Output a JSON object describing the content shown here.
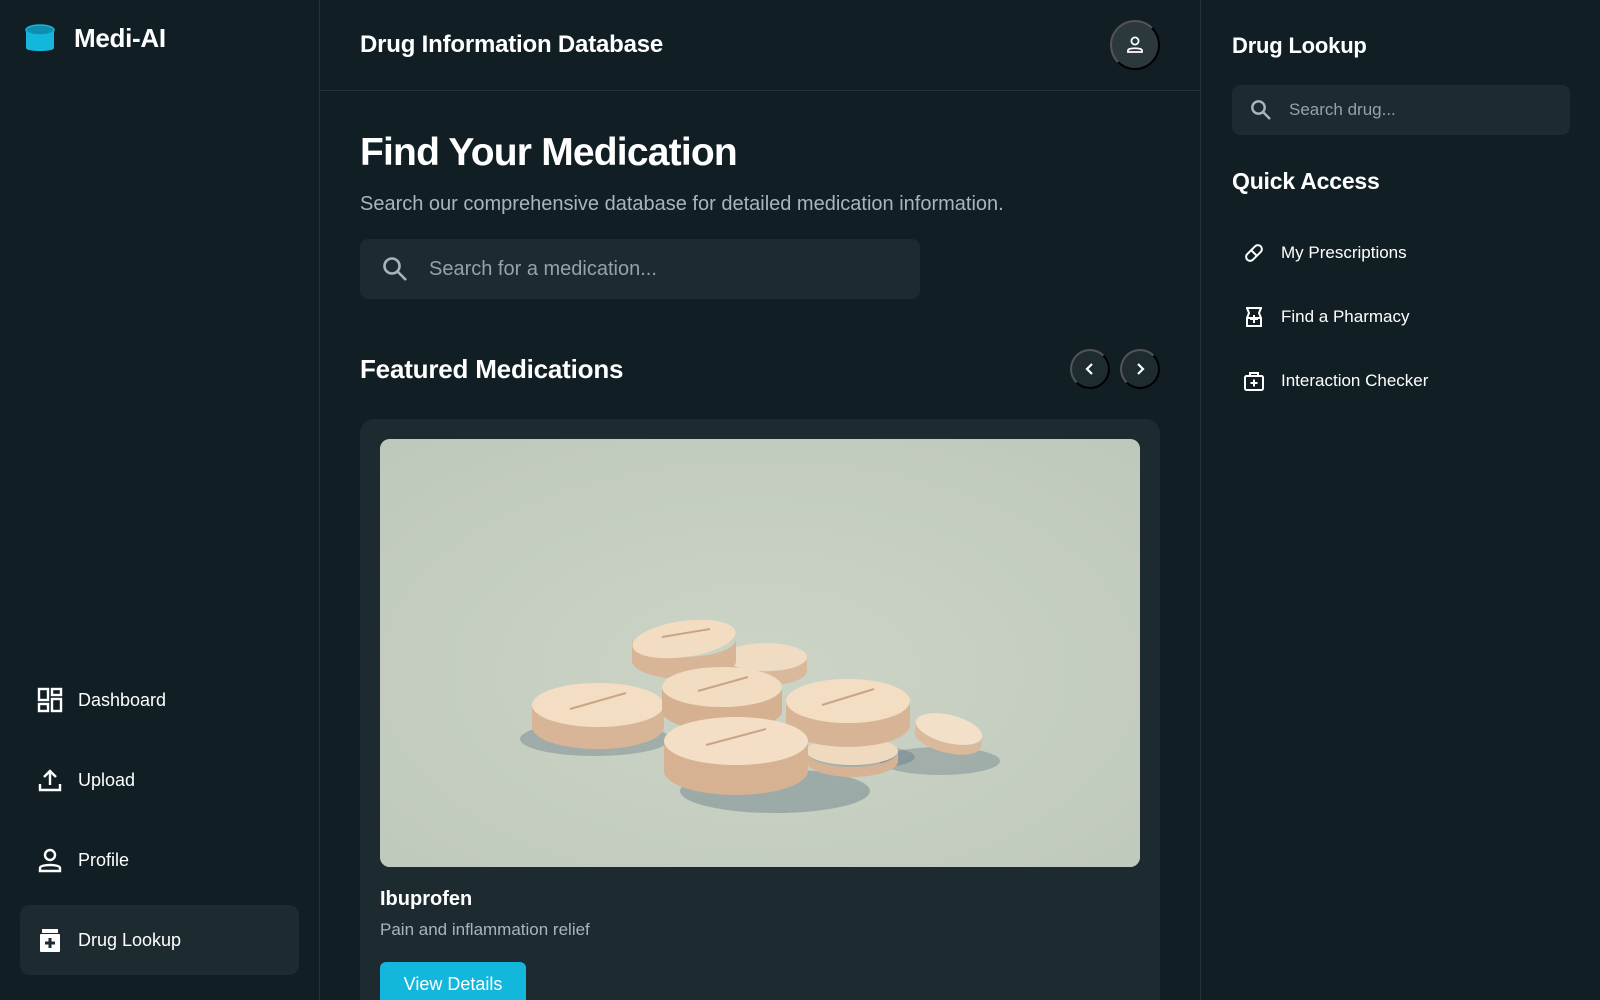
{
  "app": {
    "name": "Medi-AI"
  },
  "sidebar": {
    "items": [
      {
        "label": "Dashboard",
        "icon": "dashboard-icon",
        "active": false
      },
      {
        "label": "Upload",
        "icon": "upload-icon",
        "active": false
      },
      {
        "label": "Profile",
        "icon": "person-icon",
        "active": false
      },
      {
        "label": "Drug Lookup",
        "icon": "medication-icon",
        "active": true
      }
    ]
  },
  "header": {
    "title": "Drug Information Database",
    "avatar_icon": "person-icon"
  },
  "main": {
    "title": "Find Your Medication",
    "subtitle": "Search our comprehensive database for detailed medication information.",
    "search": {
      "placeholder": "Search for a medication...",
      "value": ""
    },
    "featured": {
      "title": "Featured Medications",
      "cards": [
        {
          "name": "Ibuprofen",
          "description": "Pain and inflammation relief",
          "button_label": "View Details",
          "image": "pills-image"
        }
      ]
    }
  },
  "right_panel": {
    "title": "Drug Lookup",
    "search": {
      "placeholder": "Search drug...",
      "value": ""
    },
    "quick_access": {
      "title": "Quick Access",
      "items": [
        {
          "label": "My Prescriptions",
          "icon": "pill-icon"
        },
        {
          "label": "Find a Pharmacy",
          "icon": "pharmacy-icon"
        },
        {
          "label": "Interaction Checker",
          "icon": "medical-kit-icon"
        }
      ]
    }
  },
  "colors": {
    "background": "#111f24",
    "surface": "#1d2b31",
    "accent": "#14b7dc",
    "muted_text": "#a9b5ba"
  }
}
